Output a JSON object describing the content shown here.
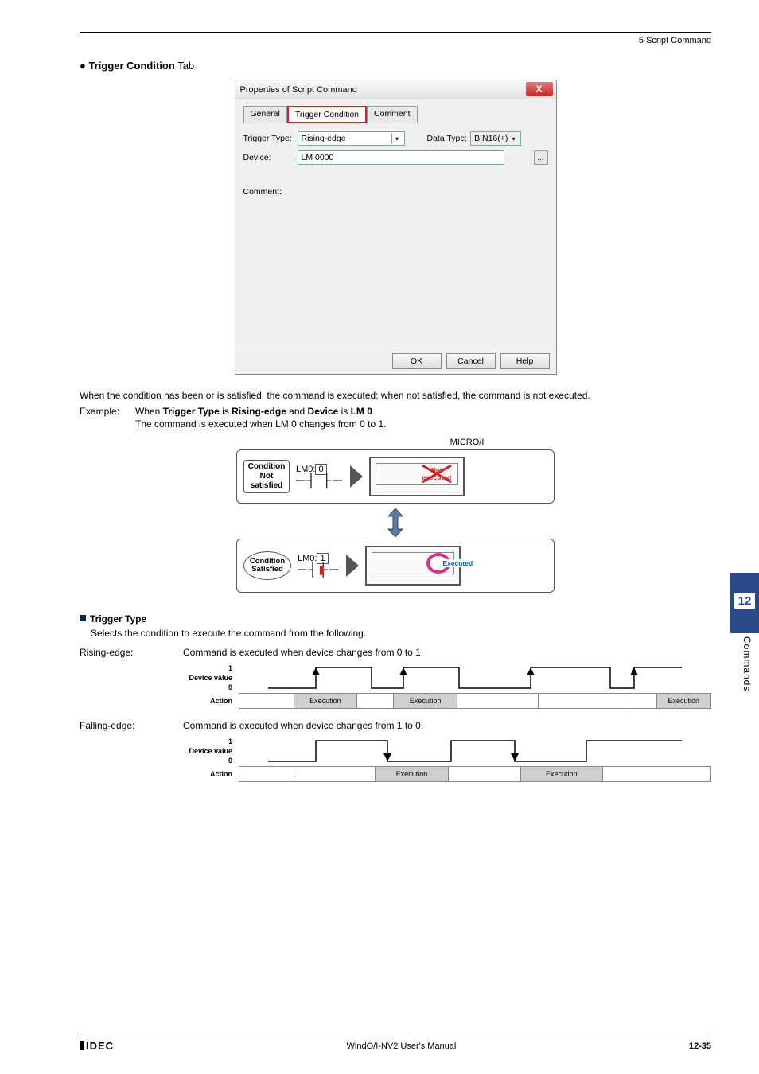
{
  "header": {
    "section": "5 Script Command"
  },
  "heading": {
    "bullet": "●",
    "bold": "Trigger Condition",
    "suffix": " Tab"
  },
  "dialog": {
    "title": "Properties of Script Command",
    "close": "X",
    "tabs": {
      "general": "General",
      "trigger": "Trigger Condition",
      "comment": "Comment"
    },
    "labels": {
      "trigger_type": "Trigger Type:",
      "data_type": "Data Type:",
      "device": "Device:",
      "comment": "Comment:"
    },
    "values": {
      "trigger_type": "Rising-edge",
      "data_type": "BIN16(+)",
      "device": "LM 0000"
    },
    "buttons": {
      "ok": "OK",
      "cancel": "Cancel",
      "help": "Help",
      "dots": "..."
    }
  },
  "explanation": {
    "p1": "When the condition has been or is satisfied, the command is executed; when not satisfied, the command is not executed.",
    "example_label": "Example:",
    "example_line1a": "When ",
    "example_line1b": "Trigger Type",
    "example_line1c": " is ",
    "example_line1d": "Rising-edge",
    "example_line1e": " and ",
    "example_line1f": "Device",
    "example_line1g": " is ",
    "example_line1h": "LM 0",
    "example_line2": "The command is executed when LM 0 changes from 0 to 1."
  },
  "diagram": {
    "micro": "MICRO/I",
    "cond_not": "Condition\nNot\nsatisfied",
    "cond_sat": "Condition\nSatisfied",
    "lm_pre": "LM0:",
    "lm0": "0",
    "lm1": "1",
    "not_exec": "Not\nexecuted",
    "exec": "Executed"
  },
  "trigger_type_section": {
    "heading": "Trigger Type",
    "desc": "Selects the condition to execute the command from the following.",
    "rising": {
      "name": "Rising-edge:",
      "desc": "Command is executed when device changes from 0 to 1."
    },
    "falling": {
      "name": "Falling-edge:",
      "desc": "Command is executed when device changes from 1 to 0."
    },
    "labels": {
      "device_value": "Device value",
      "action": "Action",
      "one": "1",
      "zero": "0",
      "execution": "Execution"
    }
  },
  "side": {
    "chapter": "12",
    "text": "Commands"
  },
  "footer": {
    "idec": "IDEC",
    "title": "WindO/I-NV2 User's Manual",
    "page": "12-35"
  }
}
